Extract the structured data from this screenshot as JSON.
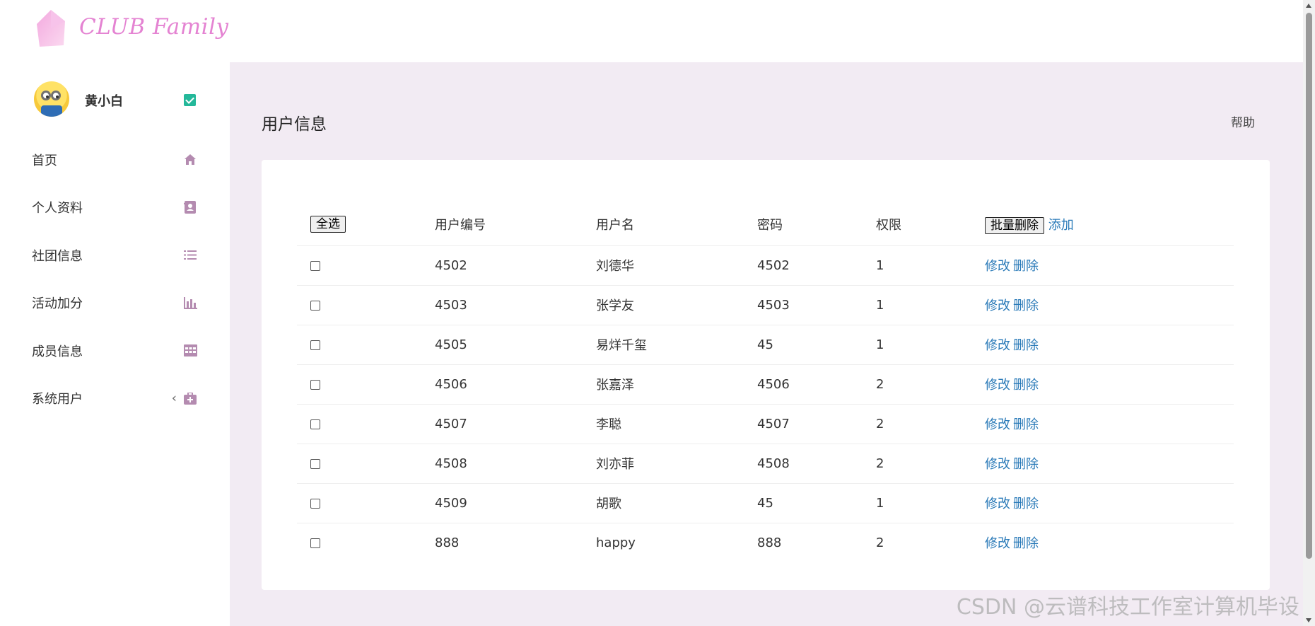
{
  "brand": {
    "name": "CLUB Family",
    "logo_color": "#f5b8e6",
    "text_color": "#e483d2"
  },
  "user": {
    "name": "黄小白",
    "verified_icon": "check-badge-icon"
  },
  "sidebar": {
    "items": [
      {
        "label": "首页",
        "icon": "home-icon"
      },
      {
        "label": "个人资料",
        "icon": "contact-card-icon"
      },
      {
        "label": "社团信息",
        "icon": "list-icon"
      },
      {
        "label": "活动加分",
        "icon": "bar-chart-icon"
      },
      {
        "label": "成员信息",
        "icon": "table-icon"
      },
      {
        "label": "系统用户",
        "icon": "medkit-icon",
        "chevron": "‹"
      }
    ]
  },
  "page": {
    "title": "用户信息",
    "help": "帮助"
  },
  "table": {
    "headers": {
      "select_all": "全选",
      "id": "用户编号",
      "username": "用户名",
      "password": "密码",
      "permission": "权限",
      "batch_delete": "批量删除",
      "add": "添加"
    },
    "rows": [
      {
        "id": "4502",
        "username": "刘德华",
        "password": "4502",
        "permission": "1"
      },
      {
        "id": "4503",
        "username": "张学友",
        "password": "4503",
        "permission": "1"
      },
      {
        "id": "4505",
        "username": "易烊千玺",
        "password": "45",
        "permission": "1"
      },
      {
        "id": "4506",
        "username": "张嘉泽",
        "password": "4506",
        "permission": "2"
      },
      {
        "id": "4507",
        "username": "李聪",
        "password": "4507",
        "permission": "2"
      },
      {
        "id": "4508",
        "username": "刘亦菲",
        "password": "4508",
        "permission": "2"
      },
      {
        "id": "4509",
        "username": "胡歌",
        "password": "45",
        "permission": "1"
      },
      {
        "id": "888",
        "username": "happy",
        "password": "888",
        "permission": "2"
      }
    ],
    "actions": {
      "edit": "修改",
      "delete": "删除"
    }
  },
  "floating_button": {
    "text": "---:---"
  },
  "watermark": "CSDN @云谱科技工作室计算机毕设",
  "colors": {
    "main_bg": "#f2ebf3",
    "link": "#2a7ab8",
    "icon": "#b48bb0",
    "verified": "#24b89a"
  }
}
